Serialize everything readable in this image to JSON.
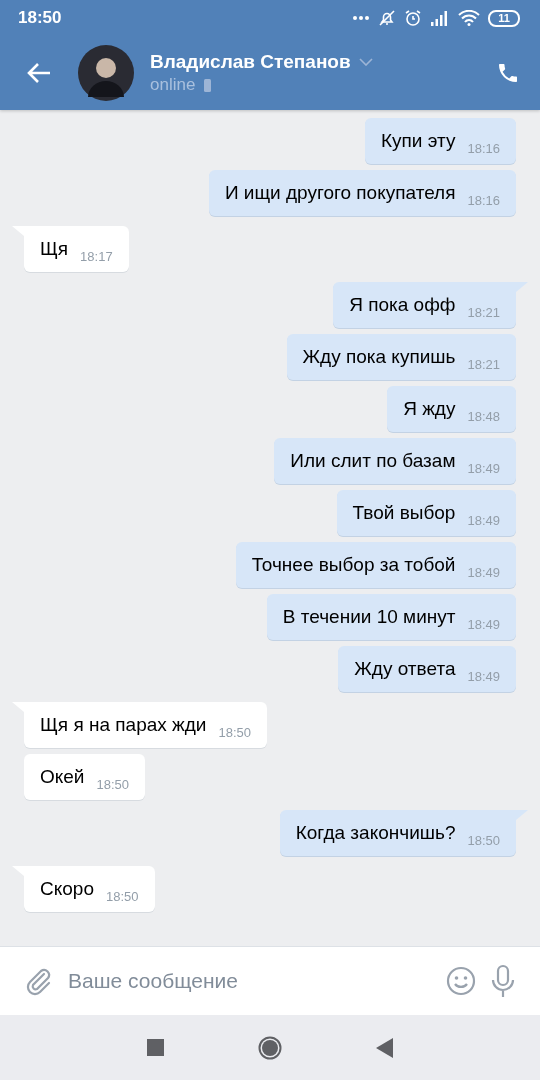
{
  "status_bar": {
    "time": "18:50",
    "battery": "11"
  },
  "header": {
    "name": "Владислав Степанов",
    "status": "online"
  },
  "messages": [
    {
      "kind": "outgoing",
      "text": "Купи эту",
      "time": "18:16"
    },
    {
      "kind": "outgoing",
      "text": "И ищи другого покупателя",
      "time": "18:16"
    },
    {
      "kind": "incoming",
      "text": "Щя",
      "time": "18:17"
    },
    {
      "kind": "outgoing",
      "text": "Я пока офф",
      "time": "18:21"
    },
    {
      "kind": "outgoing",
      "text": "Жду пока купишь",
      "time": "18:21"
    },
    {
      "kind": "outgoing",
      "text": "Я жду",
      "time": "18:48"
    },
    {
      "kind": "outgoing",
      "text": "Или слит по базам",
      "time": "18:49"
    },
    {
      "kind": "outgoing",
      "text": "Твой выбор",
      "time": "18:49"
    },
    {
      "kind": "outgoing",
      "text": "Точнее выбор за тобой",
      "time": "18:49"
    },
    {
      "kind": "outgoing",
      "text": "В течении 10 минут",
      "time": "18:49"
    },
    {
      "kind": "outgoing",
      "text": "Жду ответа",
      "time": "18:49"
    },
    {
      "kind": "incoming",
      "text": "Щя я на парах жди",
      "time": "18:50"
    },
    {
      "kind": "incoming",
      "text": "Окей",
      "time": "18:50"
    },
    {
      "kind": "outgoing",
      "text": "Когда закончишь?",
      "time": "18:50"
    },
    {
      "kind": "incoming",
      "text": "Скоро",
      "time": "18:50"
    }
  ],
  "composer": {
    "placeholder": "Ваше сообщение"
  }
}
